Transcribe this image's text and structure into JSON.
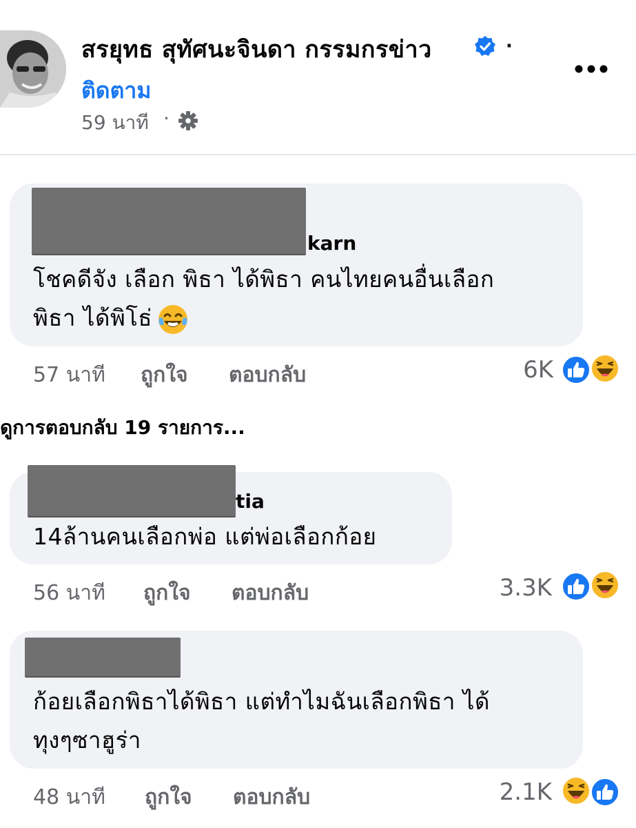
{
  "post": {
    "author_name": "สรยุทธ สุทัศนะจินดา กรรมกรข่าว",
    "name_separator": "·",
    "follow_label": "ติดตาม",
    "time": "59 นาที",
    "time_separator": "·",
    "icons": {
      "avatar": "profile-photo",
      "verified": "verified-badge-icon",
      "more": "more-options-icon",
      "privacy": "settings-gear-icon"
    },
    "accent_color": "#1877f2"
  },
  "comments": [
    {
      "name_visible_part": "karn",
      "text_line1": "โชคดีจัง เลือก พิธา ได้พิธา คนไทยคนอื่นเลือก",
      "text_line2": "พิธา ได้พิโธ่",
      "emoji": "face-with-tears-of-joy",
      "time": "57 นาที",
      "like_label": "ถูกใจ",
      "reply_label": "ตอบกลับ",
      "reaction_count": "6K",
      "reactions": [
        "like",
        "haha"
      ]
    },
    {
      "name_visible_part": "tia",
      "text_line1": "14ล้านคนเลือกพ่อ แต่พ่อเลือกก้อย",
      "time": "56 นาที",
      "like_label": "ถูกใจ",
      "reply_label": "ตอบกลับ",
      "reaction_count": "3.3K",
      "reactions": [
        "like",
        "haha"
      ]
    },
    {
      "name_visible_part": "",
      "text_line1": "ก้อยเลือกพิธาได้พิธา แต่ทำไมฉันเลือกพิธา ได้",
      "text_line2": "ทุงๆซาฮูร่า",
      "time": "48 นาที",
      "like_label": "ถูกใจ",
      "reply_label": "ตอบกลับ",
      "reaction_count": "2.1K",
      "reactions": [
        "haha",
        "like"
      ]
    }
  ],
  "view_replies_label": "ดูการตอบกลับ 19 รายการ...",
  "colors": {
    "bubble": "#f0f2f5",
    "meta_text": "#65676b",
    "like_blue": "#1877f2",
    "haha_yellow": "#f7b928",
    "redaction": "#707070"
  }
}
